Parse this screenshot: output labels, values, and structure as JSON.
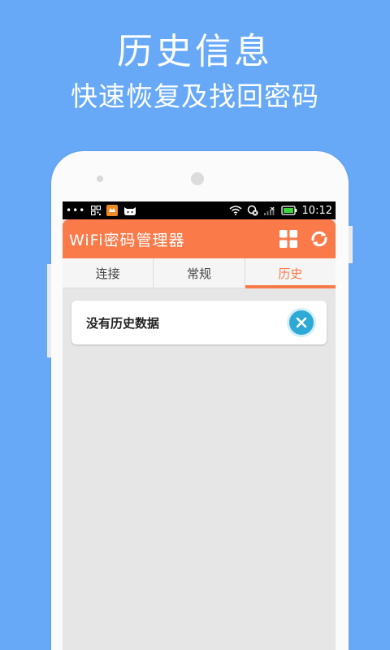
{
  "promo": {
    "title": "历史信息",
    "subtitle": "快速恢复及找回密码"
  },
  "statusbar": {
    "time": "10:12",
    "icons": [
      "more-dots-icon",
      "qr-icon",
      "game-app-icon",
      "cat-app-icon",
      "wifi-icon",
      "sync-icon",
      "signal-icon",
      "battery-icon"
    ]
  },
  "app": {
    "title": "WiFi密码管理器",
    "actions": [
      "grid-icon",
      "refresh-icon"
    ],
    "accent_color": "#fb7a4a"
  },
  "tabs": [
    {
      "label": "连接",
      "active": false
    },
    {
      "label": "常规",
      "active": false
    },
    {
      "label": "历史",
      "active": true
    }
  ],
  "history": {
    "empty_message": "没有历史数据",
    "dismiss_icon": "close-icon"
  },
  "colors": {
    "background": "#67a9f7",
    "close_button": "#2ea9d6"
  }
}
